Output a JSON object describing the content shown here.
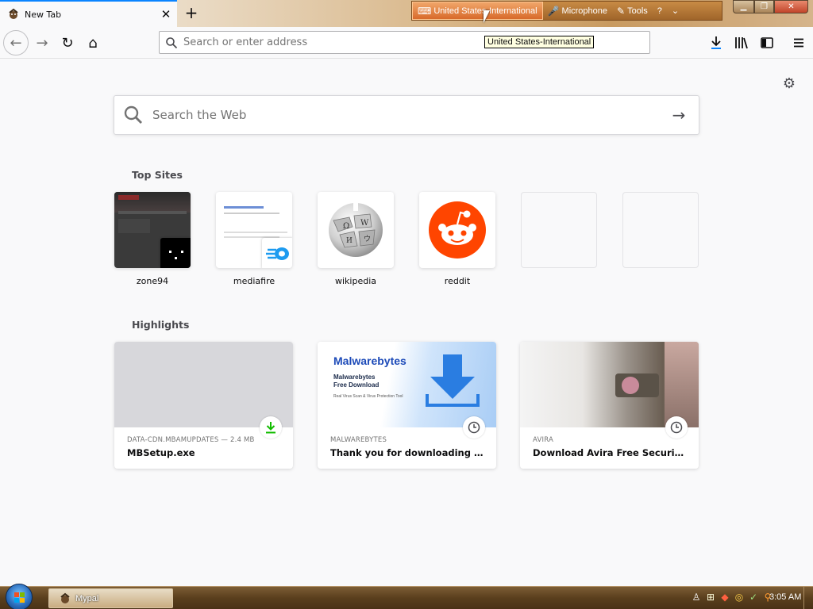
{
  "tab": {
    "title": "New Tab",
    "close": "✕",
    "new": "+"
  },
  "langbar": {
    "language": "United States-International",
    "microphone": "Microphone",
    "tools": "Tools",
    "help": "?",
    "more": "⌄"
  },
  "tooltip": "United States-International",
  "window_controls": {
    "minimize": "▁",
    "maximize": "❐",
    "close": "✕"
  },
  "nav": {
    "back": "←",
    "forward": "→",
    "reload": "↻",
    "home": "⌂"
  },
  "urlbar": {
    "placeholder": "Search or enter address",
    "value": ""
  },
  "toolbar": {
    "downloads": "↓",
    "library": "|||\\",
    "sidebar": "▥",
    "menu": "≡"
  },
  "content": {
    "search_placeholder": "Search the Web",
    "search_arrow": "→",
    "top_sites_title": "Top Sites",
    "highlights_title": "Highlights"
  },
  "top_sites": [
    {
      "label": "zone94"
    },
    {
      "label": "mediafire"
    },
    {
      "label": "wikipedia"
    },
    {
      "label": "reddit"
    },
    {
      "label": ""
    },
    {
      "label": ""
    }
  ],
  "highlights": [
    {
      "meta": "DATA-CDN.MBAMUPDATES — 2.4 MB",
      "title": "MBSetup.exe",
      "icon": "download-icon"
    },
    {
      "meta": "MALWAREBYTES",
      "title": "Thank you for downloading Mal...",
      "icon": "clock-icon",
      "image_text": {
        "brand": "Malwarebytes",
        "line1": "Malwarebytes",
        "line2": "Free Download",
        "small": "Real Virus Scan & Virus Protection Tool"
      }
    },
    {
      "meta": "AVIRA",
      "title": "Download Avira Free Security | ...",
      "icon": "clock-icon"
    }
  ],
  "taskbar": {
    "app_label": "Mypal",
    "clock": "3:05 AM"
  },
  "colors": {
    "accent": "#0a84ff",
    "reddit": "#ff4500",
    "download_green": "#12bc00",
    "malwarebytes_blue": "#1c4ab8"
  }
}
